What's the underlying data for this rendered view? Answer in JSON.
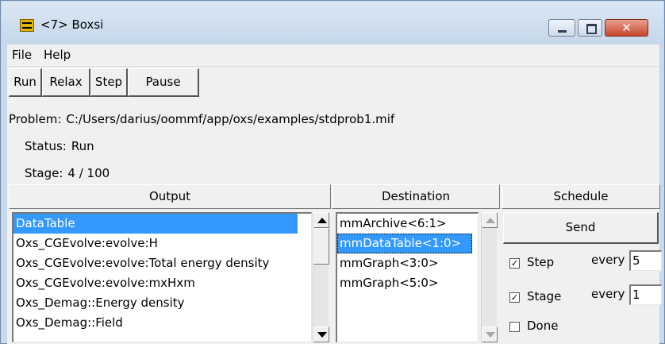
{
  "window": {
    "title": "<7> Boxsi",
    "icon": "oommf-app-icon",
    "controls": [
      "minimize-icon",
      "maximize-icon",
      "close-icon"
    ],
    "close_glyph": "✕"
  },
  "menu": {
    "file": "File",
    "help": "Help"
  },
  "toolbar": {
    "run": "Run",
    "relax": "Relax",
    "step": "Step",
    "pause": "Pause"
  },
  "info": {
    "problem_label": "Problem:",
    "problem_value": "C:/Users/darius/oommf/app/oxs/examples/stdprob1.mif",
    "status_label": "Status:",
    "status_value": "Run",
    "stage_label": "Stage:",
    "stage_value": "4 / 100"
  },
  "columns": {
    "output": "Output",
    "destination": "Destination",
    "schedule": "Schedule"
  },
  "output_list": {
    "items": [
      "DataTable",
      "Oxs_CGEvolve:evolve:H",
      "Oxs_CGEvolve:evolve:Total energy density",
      "Oxs_CGEvolve:evolve:mxHxm",
      "Oxs_Demag::Energy density",
      "Oxs_Demag::Field"
    ],
    "selected": "DataTable"
  },
  "destination_list": {
    "items": [
      "mmArchive<6:1>",
      "mmDataTable<1:0>",
      "mmGraph<3:0>",
      "mmGraph<5:0>"
    ],
    "selected": "mmDataTable<1:0>"
  },
  "schedule": {
    "send": "Send",
    "step_label": "Step",
    "step_checked": true,
    "step_every_label": "every",
    "step_every_value": "5",
    "stage_label": "Stage",
    "stage_checked": true,
    "stage_every_label": "every",
    "stage_every_value": "1",
    "done_label": "Done",
    "done_checked": false,
    "check_glyph": "✓"
  },
  "colors": {
    "selection": "#3399ff",
    "close_button": "#c7472d",
    "titlebar": "#c8d9ec"
  }
}
